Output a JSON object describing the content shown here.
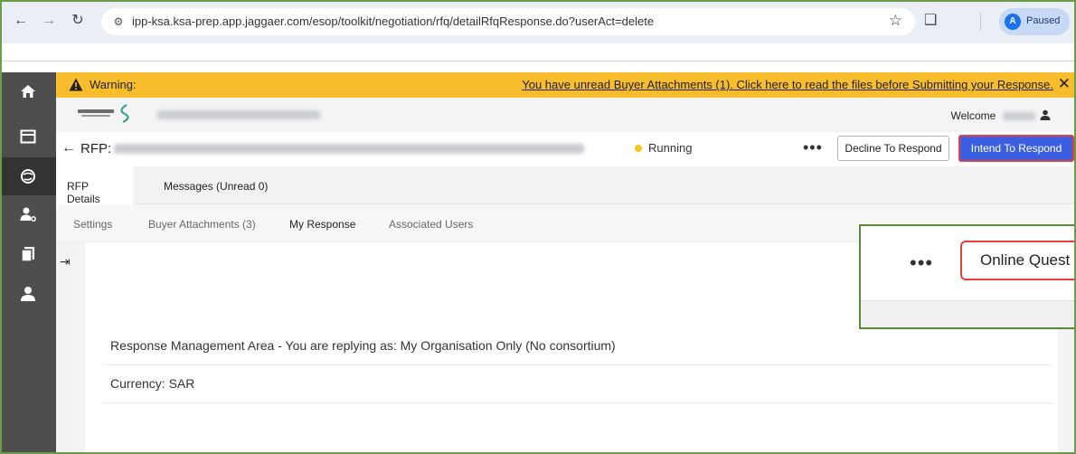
{
  "browser": {
    "url": "ipp-ksa.ksa-prep.app.jaggaer.com/esop/toolkit/negotiation/rfq/detailRfqResponse.do?userAct=delete",
    "profile_initial": "A",
    "profile_status": "Paused"
  },
  "warning": {
    "label": "Warning:",
    "link_text": "You have unread Buyer Attachments (1). Click here to read the files before Submitting your Response."
  },
  "company": {
    "welcome": "Welcome"
  },
  "rfp": {
    "title": "RFP:",
    "status": "Running",
    "status_color": "#f5c518",
    "decline_label": "Decline To Respond",
    "intend_label": "Intend To Respond"
  },
  "tabs_primary": [
    {
      "label": "RFP Details"
    },
    {
      "label": "Messages (Unread 0)"
    }
  ],
  "tabs_secondary": [
    {
      "label": "Settings"
    },
    {
      "label": "Buyer Attachments (3)"
    },
    {
      "label": "My Response"
    },
    {
      "label": "Associated Users"
    }
  ],
  "content": {
    "response_area": "Response Management Area - You are replying as: My Organisation Only (No consortium)",
    "currency": "Currency: SAR"
  },
  "callout": {
    "button_label": "Online Quest"
  },
  "colors": {
    "warning_bg": "#f8bd2d",
    "primary_button": "#3b5fe0",
    "highlight_border": "#e04040",
    "nav_bg": "#4e4e4e"
  }
}
